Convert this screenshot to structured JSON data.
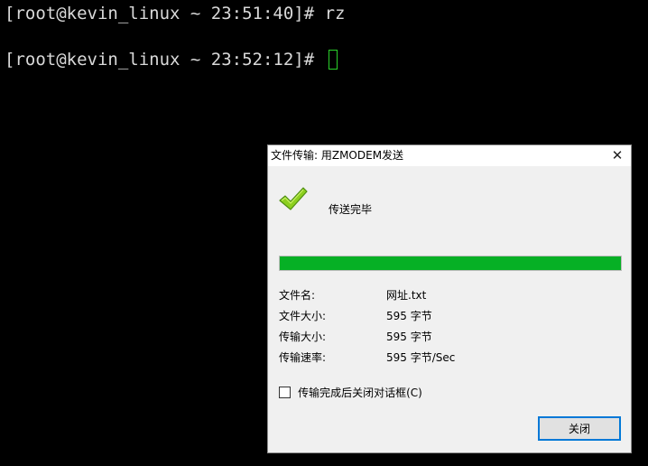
{
  "terminal": {
    "lines": [
      "[root@kevin_linux ~ 23:51:40]# rz",
      "[root@kevin_linux ~ 23:52:12]# "
    ],
    "cursor_color": "#2bd12b"
  },
  "dialog": {
    "title": "文件传输: 用ZMODEM发送",
    "close_glyph": "✕",
    "status_icon": "check-icon",
    "status_text": "传送完毕",
    "progress_fraction": 1.0,
    "progress_color": "#06b025",
    "fields": [
      {
        "label": "文件名:",
        "value": "网址.txt"
      },
      {
        "label": "文件大小:",
        "value": "595 字节"
      },
      {
        "label": "传输大小:",
        "value": "595 字节"
      },
      {
        "label": "传输速率:",
        "value": "595 字节/Sec"
      }
    ],
    "auto_close_checkbox": {
      "label": "传输完成后关闭对话框(C)",
      "checked": false
    },
    "close_button_label": "关闭",
    "accent_color": "#0078d7"
  }
}
